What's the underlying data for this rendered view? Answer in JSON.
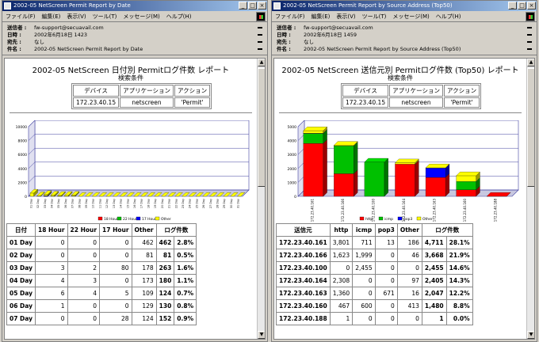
{
  "left": {
    "title": "2002-05 NetScreen Permit Report by Date",
    "menu": [
      "ファイル(F)",
      "編集(E)",
      "表示(V)",
      "ツール(T)",
      "メッセージ(M)",
      "ヘルプ(H)"
    ],
    "headers": [
      {
        "label": "送信者 :",
        "value": "fw-support@secuavail.com"
      },
      {
        "label": "日時 :",
        "value": "2002年6月18日 1423"
      },
      {
        "label": "宛先 :",
        "value": "なし"
      },
      {
        "label": "件名 :",
        "value": "2002-05 NetScreen Permit Report by Date"
      }
    ],
    "report_title": "2002-05 NetScreen 日付別 Permitログ件数 レポート",
    "search_label": "検索条件",
    "cond_headers": [
      "デバイス",
      "アプリケーション",
      "アクション"
    ],
    "cond_values": [
      "172.23.40.15",
      "netscreen",
      "'Permit'"
    ],
    "table_headers": [
      "日付",
      "18 Hour",
      "22 Hour",
      "17 Hour",
      "Other",
      "ログ件数",
      ""
    ],
    "rows": [
      [
        "01 Day",
        "0",
        "0",
        "0",
        "462",
        "462",
        "2.8%"
      ],
      [
        "02 Day",
        "0",
        "0",
        "0",
        "81",
        "81",
        "0.5%"
      ],
      [
        "03 Day",
        "3",
        "2",
        "80",
        "178",
        "263",
        "1.6%"
      ],
      [
        "04 Day",
        "4",
        "3",
        "0",
        "173",
        "180",
        "1.1%"
      ],
      [
        "05 Day",
        "6",
        "4",
        "5",
        "109",
        "124",
        "0.7%"
      ],
      [
        "06 Day",
        "1",
        "0",
        "0",
        "129",
        "130",
        "0.8%"
      ],
      [
        "07 Day",
        "0",
        "0",
        "28",
        "124",
        "152",
        "0.9%"
      ]
    ]
  },
  "right": {
    "title": "2002-05 NetScreen Permit Report by Source Address (Top50)",
    "menu": [
      "ファイル(F)",
      "編集(E)",
      "表示(V)",
      "ツール(T)",
      "メッセージ(M)",
      "ヘルプ(H)"
    ],
    "headers": [
      {
        "label": "送信者 :",
        "value": "fw-support@secuavail.com"
      },
      {
        "label": "日時 :",
        "value": "2002年6月18日 1459"
      },
      {
        "label": "宛先 :",
        "value": "なし"
      },
      {
        "label": "件名 :",
        "value": "2002-05 NetScreen Permit Report by Source Address (Top50)"
      }
    ],
    "report_title": "2002-05 NetScreen 送信元別 Permitログ件数 (Top50) レポート",
    "search_label": "検索条件",
    "cond_headers": [
      "デバイス",
      "アプリケーション",
      "アクション"
    ],
    "cond_values": [
      "172.23.40.15",
      "netscreen",
      "'Permit'"
    ],
    "table_headers": [
      "送信元",
      "http",
      "icmp",
      "pop3",
      "Other",
      "ログ件数",
      ""
    ],
    "rows": [
      [
        "172.23.40.161",
        "3,801",
        "711",
        "13",
        "186",
        "4,711",
        "28.1%"
      ],
      [
        "172.23.40.166",
        "1,623",
        "1,999",
        "0",
        "46",
        "3,668",
        "21.9%"
      ],
      [
        "172.23.40.100",
        "0",
        "2,455",
        "0",
        "0",
        "2,455",
        "14.6%"
      ],
      [
        "172.23.40.164",
        "2,308",
        "0",
        "0",
        "97",
        "2,405",
        "14.3%"
      ],
      [
        "172.23.40.163",
        "1,360",
        "0",
        "671",
        "16",
        "2,047",
        "12.2%"
      ],
      [
        "172.23.40.160",
        "467",
        "600",
        "0",
        "413",
        "1,480",
        "8.8%"
      ],
      [
        "172.23.40.188",
        "1",
        "0",
        "0",
        "0",
        "1",
        "0.0%"
      ]
    ]
  },
  "chart_data": [
    {
      "type": "bar",
      "stacked": true,
      "categories": [
        "01 Day",
        "02 Day",
        "03 Day",
        "04 Day",
        "05 Day",
        "06 Day",
        "07 Day",
        "08 Day",
        "09 Day",
        "10 Day",
        "11 Day",
        "12 Day",
        "13 Day",
        "14 Day",
        "15 Day",
        "16 Day",
        "17 Day",
        "18 Day",
        "19 Day",
        "20 Day",
        "21 Day",
        "22 Day",
        "23 Day",
        "24 Day",
        "25 Day",
        "26 Day",
        "27 Day",
        "28 Day",
        "29 Day",
        "30 Day",
        "31 Day"
      ],
      "ylim": [
        0,
        10000
      ],
      "yticks": [
        "0",
        "2000",
        "4000",
        "6000",
        "8000",
        "10000"
      ],
      "series": [
        {
          "name": "18 Hour",
          "color": "#ff0000",
          "values": [
            0,
            0,
            3,
            4,
            6,
            1,
            0,
            0,
            0,
            0,
            0,
            0,
            0,
            0,
            0,
            0,
            0,
            0,
            0,
            0,
            0,
            0,
            0,
            0,
            0,
            0,
            0,
            0,
            0,
            0,
            0
          ]
        },
        {
          "name": "22 Hour",
          "color": "#00c000",
          "values": [
            0,
            0,
            2,
            3,
            4,
            0,
            0,
            0,
            0,
            0,
            0,
            0,
            0,
            0,
            0,
            0,
            0,
            0,
            0,
            0,
            0,
            0,
            0,
            0,
            0,
            0,
            0,
            0,
            0,
            0,
            0
          ]
        },
        {
          "name": "17 Hour",
          "color": "#0000ff",
          "values": [
            0,
            0,
            80,
            0,
            5,
            0,
            28,
            0,
            0,
            0,
            0,
            0,
            0,
            0,
            0,
            0,
            0,
            0,
            0,
            0,
            0,
            0,
            0,
            0,
            0,
            0,
            0,
            0,
            0,
            0,
            0
          ]
        },
        {
          "name": "Other",
          "color": "#ffff00",
          "values": [
            462,
            81,
            178,
            173,
            109,
            129,
            124,
            0,
            0,
            0,
            0,
            0,
            0,
            0,
            0,
            0,
            0,
            0,
            0,
            0,
            0,
            0,
            0,
            0,
            0,
            0,
            0,
            0,
            0,
            0,
            0
          ]
        }
      ],
      "legend": "bottom"
    },
    {
      "type": "bar",
      "stacked": true,
      "categories": [
        "172.23.40.161",
        "172.23.40.166",
        "172.23.40.100",
        "172.23.40.164",
        "172.23.40.163",
        "172.23.40.160",
        "172.23.40.188"
      ],
      "ylim": [
        0,
        5000
      ],
      "yticks": [
        "0",
        "1000",
        "2000",
        "3000",
        "4000",
        "5000"
      ],
      "series": [
        {
          "name": "http",
          "color": "#ff0000",
          "values": [
            3801,
            1623,
            0,
            2308,
            1360,
            467,
            1
          ]
        },
        {
          "name": "icmp",
          "color": "#00c000",
          "values": [
            711,
            1999,
            2455,
            0,
            0,
            600,
            0
          ]
        },
        {
          "name": "pop3",
          "color": "#0000ff",
          "values": [
            13,
            0,
            0,
            0,
            671,
            0,
            0
          ]
        },
        {
          "name": "Other",
          "color": "#ffff00",
          "values": [
            186,
            46,
            0,
            97,
            16,
            413,
            0
          ]
        }
      ],
      "legend": "bottom"
    }
  ]
}
